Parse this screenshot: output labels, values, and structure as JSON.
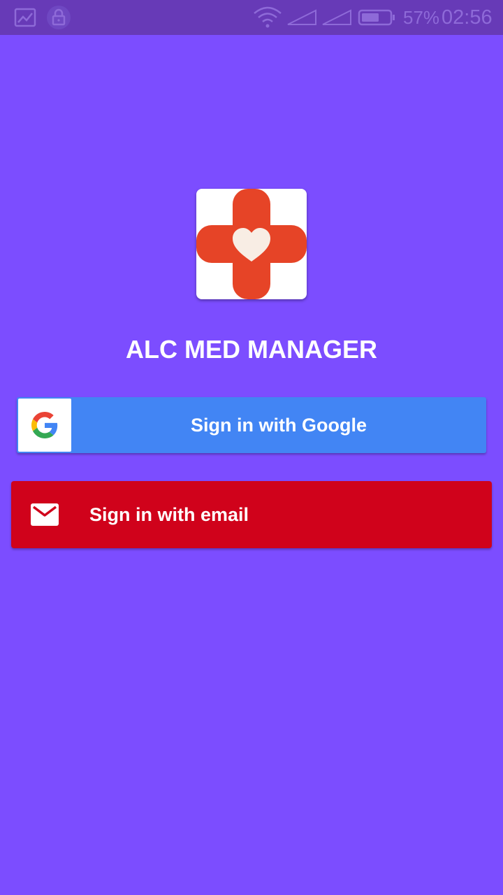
{
  "status_bar": {
    "battery_percent": "57%",
    "time": "02:56",
    "icons": [
      "gallery-icon",
      "lock-icon",
      "wifi-icon",
      "signal-icon",
      "signal-icon",
      "battery-icon"
    ],
    "battery_level": 0.57
  },
  "app": {
    "title": "ALC MED MANAGER",
    "logo": "medical-cross-heart-logo"
  },
  "auth": {
    "google_label": "Sign in with Google",
    "email_label": "Sign in with email"
  },
  "colors": {
    "background": "#7c4dff",
    "status_bar": "#673ab7",
    "google_button": "#4285f4",
    "email_button": "#d0021b",
    "logo_cross": "#e64427",
    "logo_heart": "#f8ede4"
  }
}
